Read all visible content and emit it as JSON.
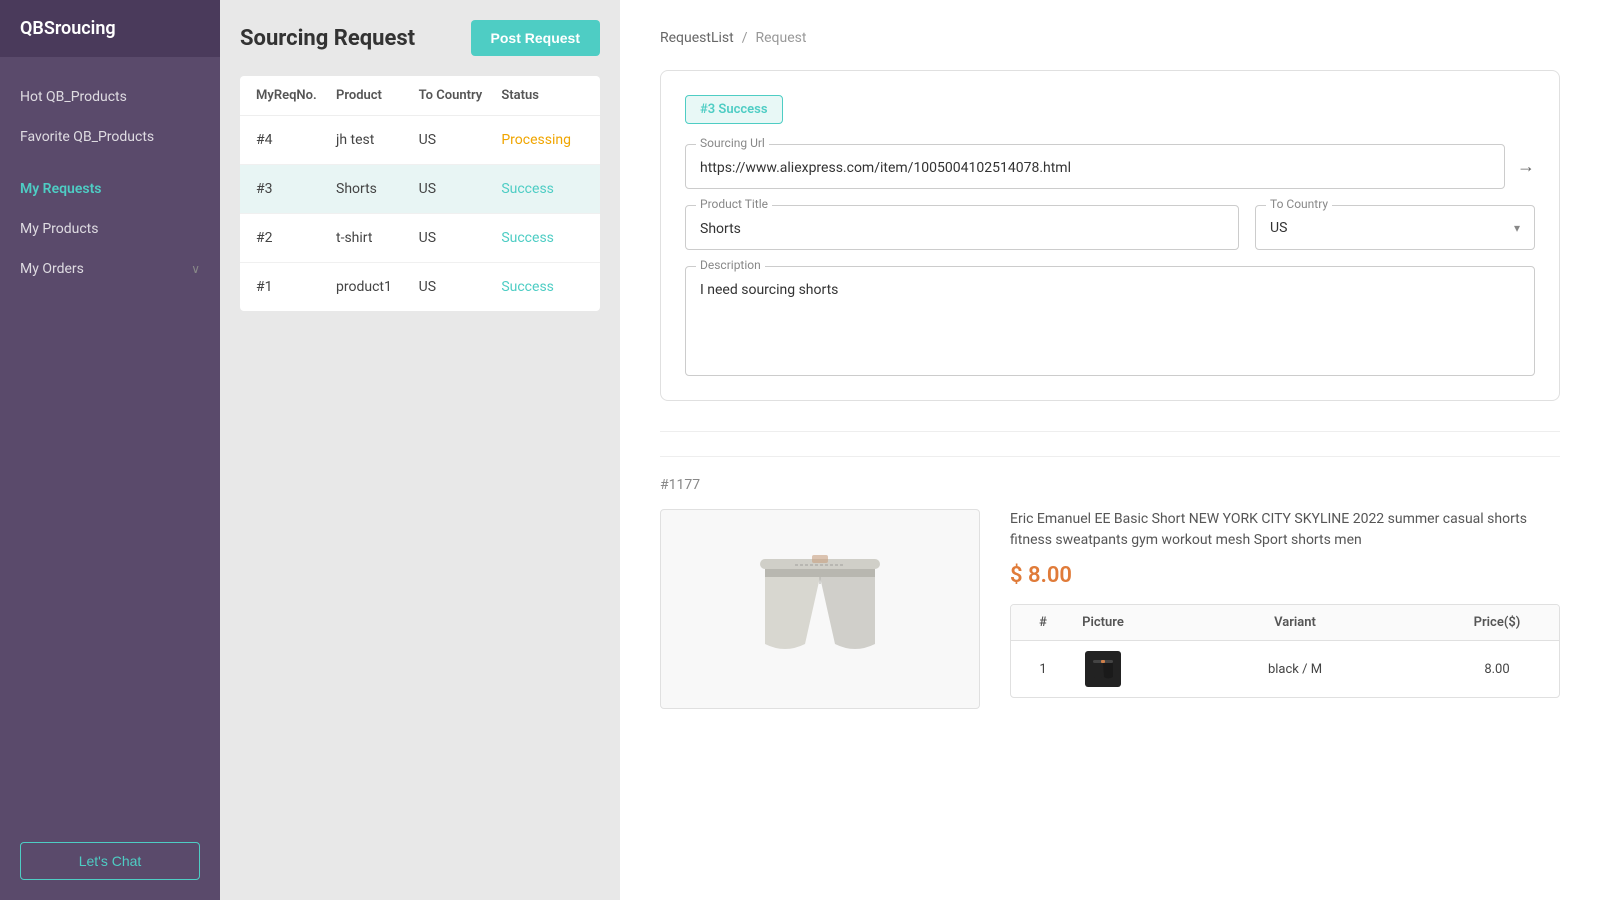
{
  "sidebar": {
    "logo": "QBSroucing",
    "nav_items": [
      {
        "id": "hot-qb-products",
        "label": "Hot QB_Products",
        "active": false,
        "sub": false
      },
      {
        "id": "favorite-qb-products",
        "label": "Favorite QB_Products",
        "active": false,
        "sub": false
      },
      {
        "id": "my-requests",
        "label": "My Requests",
        "active": true,
        "sub": false
      },
      {
        "id": "my-products",
        "label": "My Products",
        "active": false,
        "sub": false
      },
      {
        "id": "my-orders",
        "label": "My Orders",
        "active": false,
        "sub": false,
        "has_chevron": true
      }
    ],
    "chat_button": "Let's Chat"
  },
  "sourcing_panel": {
    "title": "Sourcing Request",
    "post_button": "Post Request",
    "table": {
      "headers": [
        "MyReqNo.",
        "Product",
        "To Country",
        "Status"
      ],
      "rows": [
        {
          "req_no": "#4",
          "product": "jh test",
          "country": "US",
          "status": "Processing",
          "status_type": "processing"
        },
        {
          "req_no": "#3",
          "product": "Shorts",
          "country": "US",
          "status": "Success",
          "status_type": "success",
          "selected": true
        },
        {
          "req_no": "#2",
          "product": "t-shirt",
          "country": "US",
          "status": "Success",
          "status_type": "success"
        },
        {
          "req_no": "#1",
          "product": "product1",
          "country": "US",
          "status": "Success",
          "status_type": "success"
        }
      ]
    }
  },
  "request_detail": {
    "breadcrumb": {
      "list_label": "RequestList",
      "separator": "/",
      "current": "Request"
    },
    "badge": "#3 Success",
    "sourcing_url": {
      "label": "Sourcing Url",
      "value": "https://www.aliexpress.com/item/1005004102514078.html"
    },
    "product_title": {
      "label": "Product Title",
      "value": "Shorts"
    },
    "to_country": {
      "label": "To Country",
      "value": "US"
    },
    "description": {
      "label": "Description",
      "value": "I need sourcing shorts"
    }
  },
  "product_result": {
    "product_id": "#1177",
    "product_name": "Eric Emanuel EE Basic Short NEW YORK CITY SKYLINE 2022 summer casual shorts fitness sweatpants gym workout mesh Sport shorts men",
    "price": "$ 8.00",
    "variant_table": {
      "headers": [
        "#",
        "Picture",
        "Variant",
        "Price($)"
      ],
      "rows": [
        {
          "num": "1",
          "variant": "black / M",
          "price": "8.00"
        }
      ]
    }
  },
  "colors": {
    "accent": "#4ecdc4",
    "processing": "#f0a500",
    "success": "#4ecdc4",
    "price": "#e07b39",
    "sidebar_bg": "#5a4a6b"
  }
}
